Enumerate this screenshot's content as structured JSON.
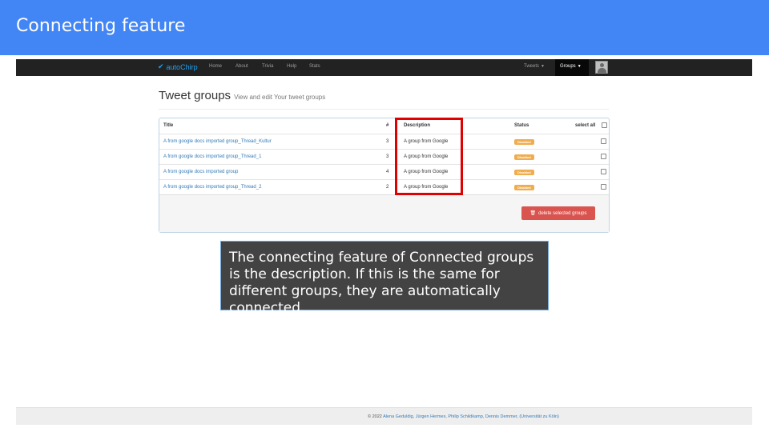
{
  "slide": {
    "title": "Connecting feature"
  },
  "navbar": {
    "brand": "autoChirp",
    "links": [
      "Home",
      "About",
      "Trivia",
      "Help",
      "Stats"
    ],
    "tweets_dropdown": "Tweets",
    "groups_dropdown": "Groups"
  },
  "page": {
    "title": "Tweet groups",
    "subtitle": "View and edit Your tweet groups"
  },
  "table": {
    "headers": {
      "title": "Title",
      "number": "#",
      "description": "Description",
      "status": "Status",
      "select_all": "select all"
    },
    "rows": [
      {
        "title": "A from google docs imported group_Thread_Kultur",
        "number": "3",
        "description": "A group from Google",
        "status": "Disabled"
      },
      {
        "title": "A from google docs imported group_Thread_1",
        "number": "3",
        "description": "A group from Google",
        "status": "Disabled"
      },
      {
        "title": "A from google docs imported group",
        "number": "4",
        "description": "A group from Google",
        "status": "Disabled"
      },
      {
        "title": "A from google docs imported group_Thread_2",
        "number": "2",
        "description": "A group from Google",
        "status": "Disabled"
      }
    ],
    "delete_button": "delete selected groups"
  },
  "callout": {
    "text": "The connecting feature of Connected groups is the description. If this is the same for different groups, they are automatically connected."
  },
  "footer": {
    "copyright": "© 2022",
    "authors": "Alena Geduldig, Jürgen Hermes, Philip Schildkamp, Dennis Demmer, (Universität zu Köln)"
  },
  "colors": {
    "slide_header": "#4285f4",
    "navbar": "#222222",
    "brand": "#1da1f2",
    "link": "#337ab7",
    "badge": "#f0ad4e",
    "danger": "#d9534f",
    "highlight": "#e00000",
    "callout_bg": "#434343"
  },
  "icons": {
    "brand": "twitter-bird-icon",
    "delete": "trash-icon",
    "avatar": "user-avatar-icon"
  }
}
